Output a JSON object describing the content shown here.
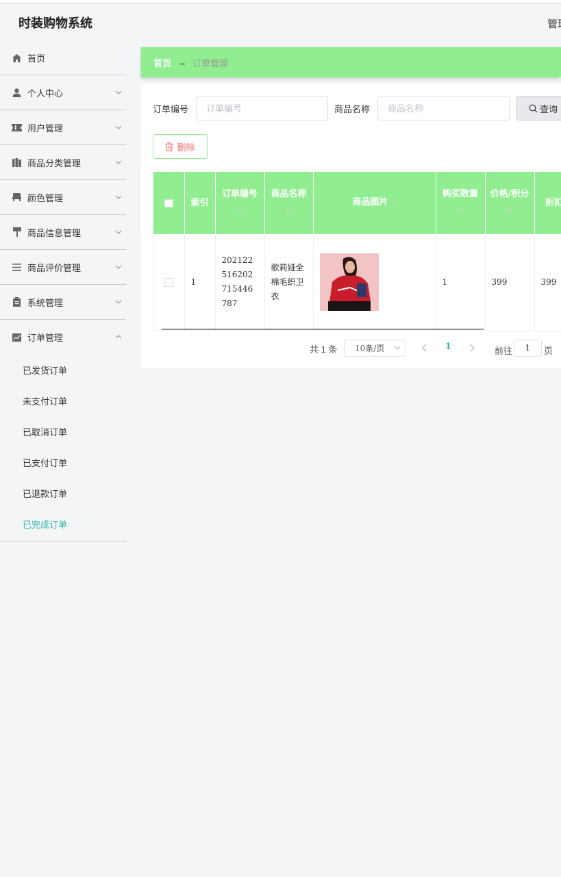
{
  "app": {
    "title": "时装购物系统",
    "header_right": "管理"
  },
  "sidebar": {
    "items": [
      {
        "label": "首页",
        "icon": "home-icon",
        "has_chevron": false
      },
      {
        "label": "个人中心",
        "icon": "user-icon",
        "has_chevron": true
      },
      {
        "label": "用户管理",
        "icon": "ticket-icon",
        "has_chevron": true
      },
      {
        "label": "商品分类管理",
        "icon": "books-icon",
        "has_chevron": true
      },
      {
        "label": "颜色管理",
        "icon": "sofa-icon",
        "has_chevron": true
      },
      {
        "label": "商品信息管理",
        "icon": "paint-roller-icon",
        "has_chevron": true
      },
      {
        "label": "商品评价管理",
        "icon": "list-icon",
        "has_chevron": true
      },
      {
        "label": "系统管理",
        "icon": "clipboard-icon",
        "has_chevron": true
      },
      {
        "label": "订单管理",
        "icon": "chart-icon",
        "has_chevron": true,
        "expanded": true
      }
    ],
    "subitems": [
      {
        "label": "已发货订单"
      },
      {
        "label": "未支付订单"
      },
      {
        "label": "已取消订单"
      },
      {
        "label": "已支付订单"
      },
      {
        "label": "已退款订单"
      },
      {
        "label": "已完成订单",
        "active": true
      }
    ]
  },
  "breadcrumb": {
    "home": "首页",
    "separator": "→",
    "current": "订单管理"
  },
  "search": {
    "order_no_label": "订单编号",
    "order_no_placeholder": "订单编号",
    "order_no_value": "",
    "product_name_label": "商品名称",
    "product_name_placeholder": "商品名称",
    "product_name_value": "",
    "query_button": "查询"
  },
  "actions": {
    "delete_button": "删除"
  },
  "table": {
    "headers": [
      "",
      "索引",
      "订单编号",
      "商品名称",
      "商品图片",
      "购买数量",
      "价格/积分",
      "折扣价格"
    ],
    "rows": [
      {
        "index": "1",
        "order_no": "202122516202715446787",
        "product_name": "歌莉娅全棉毛织卫衣",
        "image": "product-photo-red-sweater",
        "quantity": "1",
        "price": "399",
        "discount_price": "399"
      }
    ]
  },
  "pagination": {
    "total": "共 1 条",
    "page_size": "10条/页",
    "current_page": "1",
    "goto_label": "前往",
    "goto_value": "1",
    "page_suffix": "页"
  },
  "colors": {
    "accent": "#90ee90",
    "active_text": "#2ab5a5",
    "danger": "#f56c6c"
  }
}
